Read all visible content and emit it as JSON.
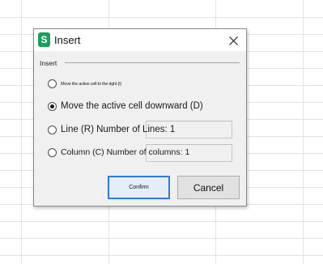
{
  "dialog": {
    "title": "Insert",
    "app_icon_letter": "S",
    "group_label": "Insert",
    "options": [
      {
        "label": "Move the active cell to the right (I)",
        "checked": false
      },
      {
        "label": "Move the active cell downward (D)",
        "checked": true
      },
      {
        "label": "Line (R) Number of Lines: 1",
        "checked": false
      },
      {
        "label": "Column (C) Number of columns: 1",
        "checked": false
      }
    ],
    "confirm_label": "Confirm",
    "cancel_label": "Cancel"
  },
  "colors": {
    "dialog_bg": "#f0f0f0",
    "app_icon": "#1aa05a",
    "focus_border": "#2f7ad9",
    "gridline": "#e3e3e3"
  },
  "icons": {
    "app": "spreadsheet-app-icon",
    "close": "close-icon"
  }
}
